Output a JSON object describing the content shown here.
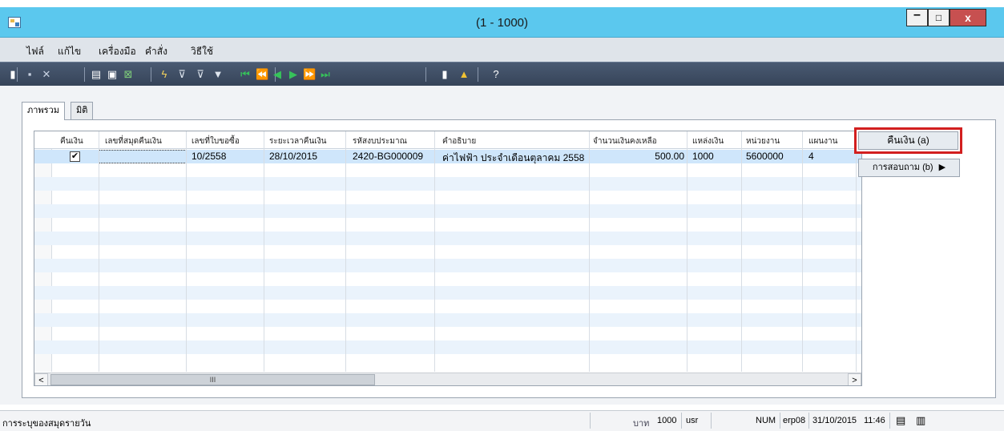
{
  "window": {
    "title": "(1 - 1000)",
    "min": "–",
    "max": "□",
    "close": "x"
  },
  "menu": [
    "ไฟล์",
    "แก้ไข",
    "เครื่องมือ",
    "คำสั่ง",
    "วิธีใช้"
  ],
  "toolbar_icons": [
    {
      "name": "new-icon",
      "glyph": "▮",
      "color": "#ffffff"
    },
    {
      "name": "save-icon",
      "glyph": "▪",
      "color": "#c9d3e3"
    },
    {
      "name": "delete-icon",
      "glyph": "✕",
      "color": "#c9d3e3"
    },
    {
      "name": "print-icon",
      "glyph": "▤",
      "color": "#ffffff"
    },
    {
      "name": "print-preview-icon",
      "glyph": "▣",
      "color": "#ffffff"
    },
    {
      "name": "export-excel-icon",
      "glyph": "⊠",
      "color": "#7fcf7a"
    },
    {
      "name": "filter-by-selection-icon",
      "glyph": "ϟ",
      "color": "#f5d35c"
    },
    {
      "name": "filter-by-grid-icon",
      "glyph": "⊽",
      "color": "#dfe6ef"
    },
    {
      "name": "advanced-filter-icon",
      "glyph": "⊽",
      "color": "#dfe6ef"
    },
    {
      "name": "clear-filter-icon",
      "glyph": "▼",
      "color": "#dfe6ef"
    },
    {
      "name": "first-record-icon",
      "glyph": "⏮",
      "color": "#36c35a"
    },
    {
      "name": "previous-page-icon",
      "glyph": "⏪",
      "color": "#36c35a"
    },
    {
      "name": "previous-record-icon",
      "glyph": "◀",
      "color": "#36c35a"
    },
    {
      "name": "next-record-icon",
      "glyph": "▶",
      "color": "#36c35a"
    },
    {
      "name": "next-page-icon",
      "glyph": "⏩",
      "color": "#36c35a"
    },
    {
      "name": "last-record-icon",
      "glyph": "⏭",
      "color": "#36c35a"
    },
    {
      "name": "attachment-icon",
      "glyph": "▮",
      "color": "#ffffff"
    },
    {
      "name": "alert-icon",
      "glyph": "▲",
      "color": "#f1c232"
    },
    {
      "name": "help-icon",
      "glyph": "?",
      "color": "#ffffff"
    }
  ],
  "tabs": [
    "ภาพรวม",
    "มิติ"
  ],
  "grid": {
    "headers": [
      "คืนเงิน",
      "เลขที่สมุดคืนเงิน",
      "เลขที่ใบขอซื้อ",
      "ระยะเวลาคืนเงิน",
      "รหัสงบประมาณ",
      "คำอธิบาย",
      "จำนวนเงินคงเหลือ",
      "แหล่งเงิน",
      "หน่วยงาน",
      "แผนงาน"
    ],
    "rows": [
      {
        "refund_checked": "✔",
        "voucher_no": "",
        "pr_no": "10/2558",
        "refund_date": "28/10/2015",
        "budget_code": "2420-BG000009",
        "description": "ค่าไฟฟ้า ประจำเดือนตุลาคม 2558",
        "amount": "500.00",
        "fund": "1000",
        "unit": "5600000",
        "plan": "4"
      }
    ],
    "scroll_thumb": "III",
    "scroll_left": "<",
    "scroll_right": ">"
  },
  "actions": {
    "refund": "คืนเงิน (a)",
    "inquiry": "การสอบถาม (b)",
    "inquiry_arrow": "▶"
  },
  "status": {
    "text": "การระบุของสมุดรายวัน",
    "currency": "บาท",
    "company": "1000",
    "user": "usr",
    "numlock": "NUM",
    "server": "erp08",
    "date": "31/10/2015",
    "time": "11:46"
  }
}
